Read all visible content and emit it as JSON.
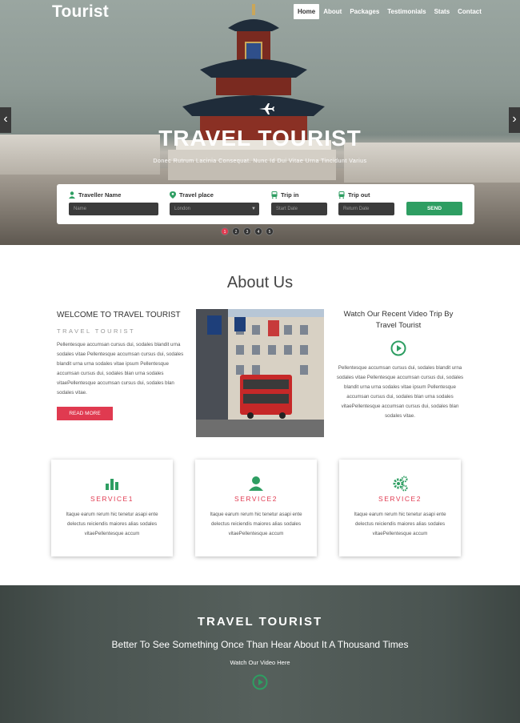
{
  "brand": "Tourist",
  "nav": [
    "Home",
    "About",
    "Packages",
    "Testimonials",
    "Stats",
    "Contact"
  ],
  "hero": {
    "title": "TRAVEL TOURIST",
    "subtitle": "Donec Rutrum Lacinia Consequat. Nunc Id Dui Vitae Urna Tincidunt Varius"
  },
  "booking": {
    "traveller_label": "Traveller Name",
    "traveller_placeholder": "Name",
    "place_label": "Travel place",
    "place_value": "London",
    "trip_in_label": "Trip in",
    "trip_in_placeholder": "Start Date",
    "trip_out_label": "Trip out",
    "trip_out_placeholder": "Return Date",
    "send_label": "SEND"
  },
  "slider": {
    "dots": [
      "1",
      "2",
      "3",
      "4",
      "5"
    ],
    "active": 1
  },
  "about": {
    "title": "About Us",
    "welcome": "WELCOME TO TRAVEL TOURIST",
    "welcome_sub": "TRAVEL TOURIST",
    "text": "Pellentesque accumsan cursus dui, sodales blandit urna sodales vitae Pellentesque accumsan cursus dui, sodales blandit urna urna sodales vitae ipsum Pellentesque accumsan cursus dui, sodales blan urna sodales vitaePellentesque accumsan cursus dui, sodales blan sodales vitae.",
    "readmore": "READ MORE",
    "video_heading": "Watch Our Recent Video Trip By Travel Tourist",
    "video_text": "Pellentesque accumsan cursus dui, sodales blandit urna sodales vitae Pellentesque accumsan cursus dui, sodales blandit urna urna sodales vitae ipsum Pellentesque accumsan cursus dui, sodales blan urna sodales vitaePellentesque accumsan cursus dui, sodales blan sodales vitae."
  },
  "services": [
    {
      "icon": "bar-chart-icon",
      "title": "SERVICE1",
      "text": "Itaque earum rerum hic tenetur asapi ente delectus reiciendis maiores alias sodales vitaePellentesque accum"
    },
    {
      "icon": "user-icon",
      "title": "SERVICE2",
      "text": "Itaque earum rerum hic tenetur asapi ente delectus reiciendis maiores alias sodales vitaePellentesque accum"
    },
    {
      "icon": "gears-icon",
      "title": "SERVICE2",
      "text": "Itaque earum rerum hic tenetur asapi ente delectus reiciendis maiores alias sodales vitaePellentesque accum"
    }
  ],
  "banner": {
    "title": "TRAVEL TOURIST",
    "quote": "Better To See Something Once Than Hear About It A Thousand Times",
    "link": "Watch Our Video Here"
  },
  "colors": {
    "accent": "#e03a50",
    "green": "#2e9e62",
    "dark": "#3b3b3b"
  }
}
